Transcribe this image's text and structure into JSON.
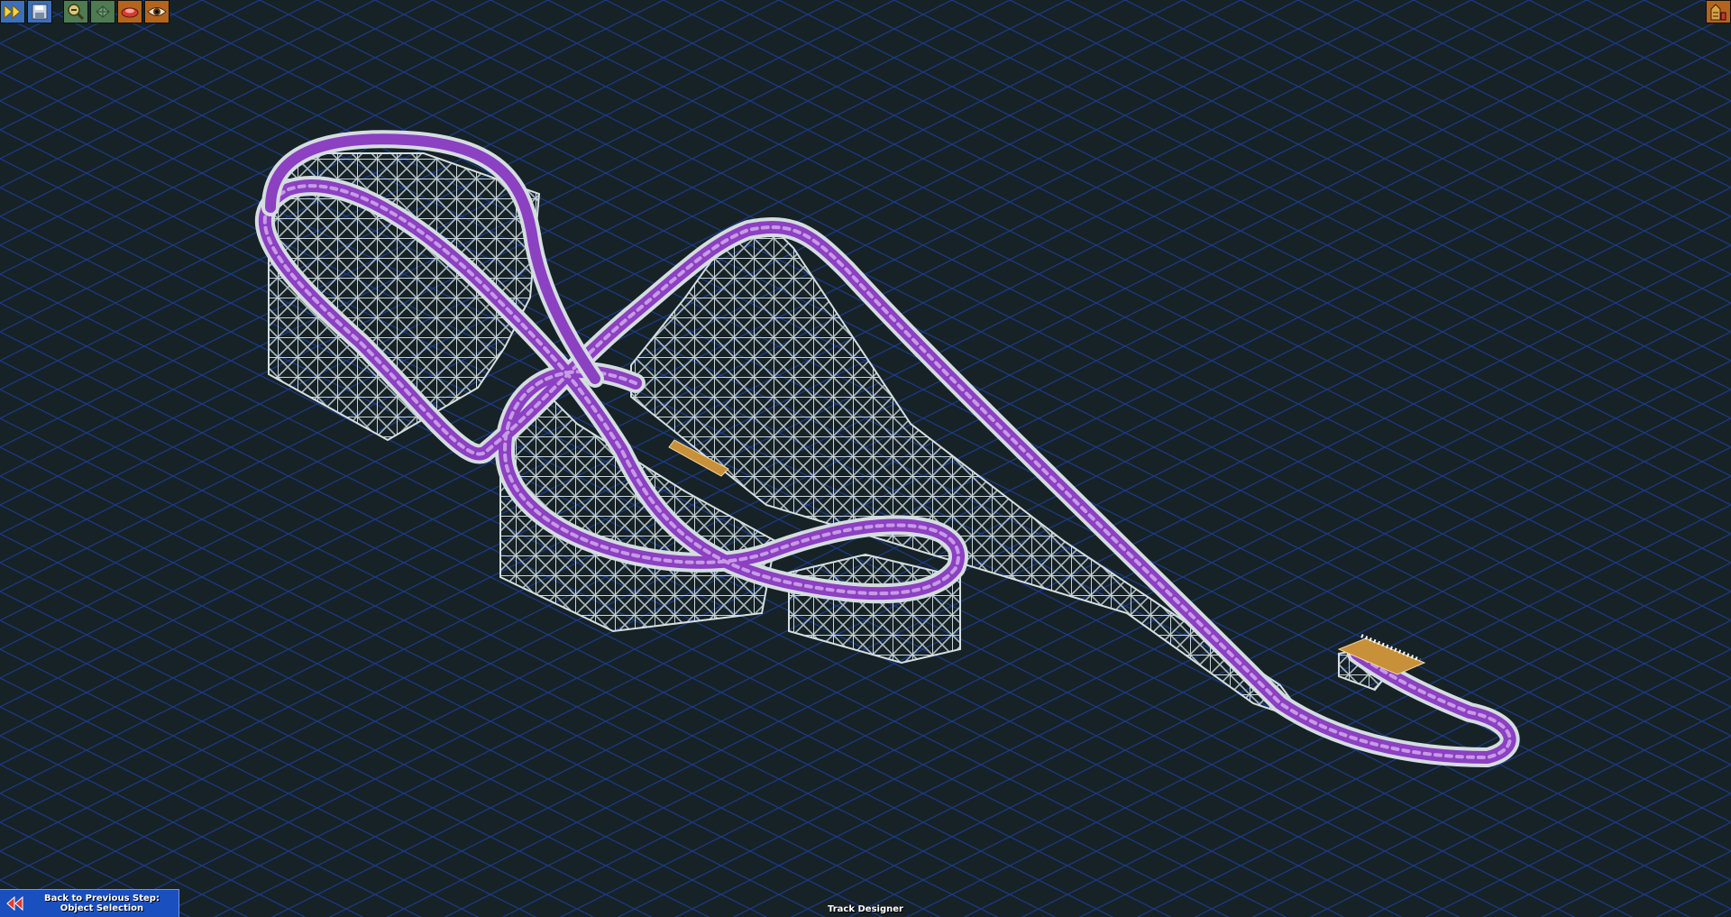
{
  "app": {
    "mode": "Track Designer"
  },
  "toolbar": {
    "left": [
      {
        "name": "fast-forward-icon",
        "color": "#3e6fb9"
      },
      {
        "name": "save-icon",
        "color": "#3e6fb9"
      },
      {
        "name": "zoom-out-icon",
        "color": "#4f7a52"
      },
      {
        "name": "rotate-view-icon",
        "color": "#4f7a52"
      },
      {
        "name": "view-options-icon",
        "color": "#b3651f"
      },
      {
        "name": "eye-icon",
        "color": "#b3651f"
      }
    ],
    "right": [
      {
        "name": "ride-construction-icon",
        "color": "#b3651f"
      }
    ]
  },
  "footer": {
    "back_line1": "Back to Previous Step:",
    "back_line2": "Object Selection",
    "back_icon": "double-left-arrow-icon",
    "status": "Track Designer"
  },
  "colors": {
    "background": "#172226",
    "grid": "#1b3a8e",
    "track_rail": "#8c40c2",
    "track_rail_light": "#c79ae6",
    "supports": "#b8c6c9",
    "support_shadow": "#7c8b90",
    "station": "#c9903a"
  }
}
